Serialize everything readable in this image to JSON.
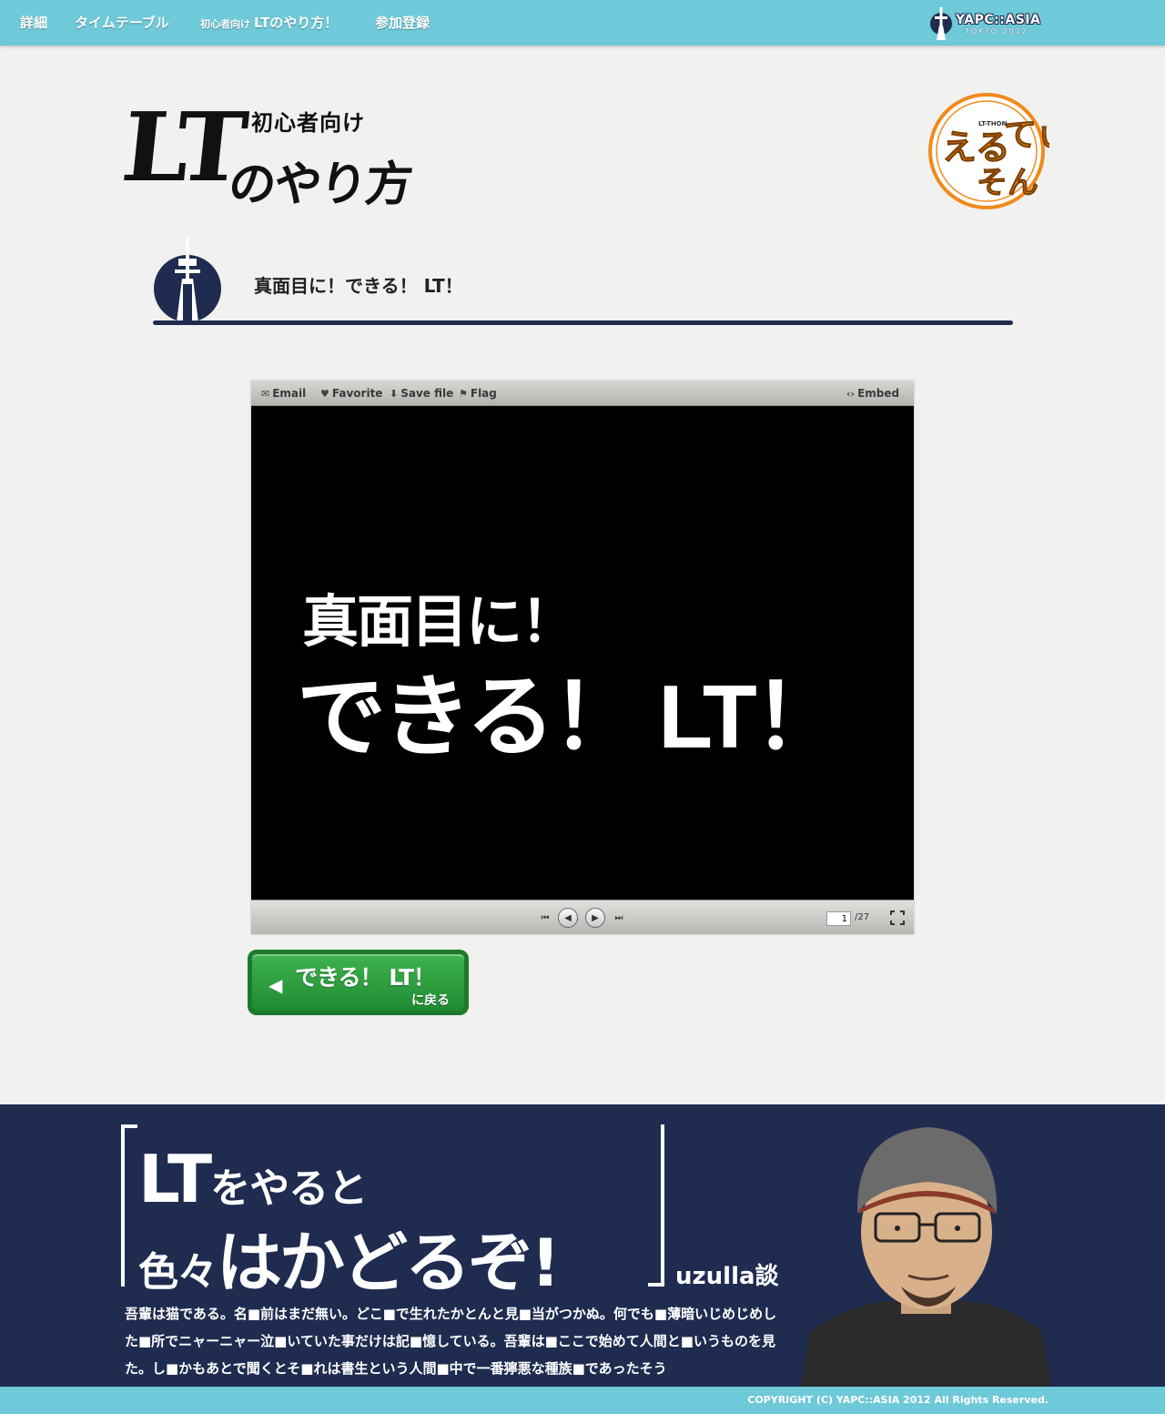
{
  "nav": {
    "items": [
      {
        "label": "詳細"
      },
      {
        "label": "タイムテーブル"
      },
      {
        "prefix": "初心者向け",
        "label": "LTのやり方！"
      },
      {
        "label": "参加登録"
      }
    ],
    "logo": {
      "title": "YAPC::ASIA",
      "subtitle": "TOKYO 2012"
    }
  },
  "header": {
    "title_prefix": "初心者向け",
    "title_lt": "LT",
    "title_rest": "のやり方",
    "badge": {
      "label": "えるてぃーそん",
      "small_text": "LT-THON",
      "icon": "lt-thon-badge-icon"
    }
  },
  "section": {
    "icon": "tower-icon",
    "title": "真面目に！できる！ LT！"
  },
  "viewer": {
    "toolbar": {
      "email": "Email",
      "favorite": "Favorite",
      "save_file": "Save file",
      "flag": "Flag",
      "embed": "Embed"
    },
    "slide": {
      "line1": "真面目に！",
      "line2": "できる！ LT！"
    },
    "controls": {
      "current_page": "1",
      "total_pages": "/27"
    }
  },
  "back_button": {
    "main": "できる！ LT！",
    "sub": "に戻る"
  },
  "promo": {
    "headline1_big": "LT",
    "headline1_rest": "をやると",
    "headline2_small": "色々",
    "headline2_big": "はかどるぞ!",
    "attribution": "uzulla談",
    "body": "吾輩は猫である。名■前はまだ無い。どこ■で生れたかとんと見■当がつかぬ。何でも■薄暗いじめじめした■所でニャーニャー泣■いていた事だけは記■憶している。吾輩は■ここで始めて人間と■いうものを見た。し■かもあとで聞くとそ■れは書生という人間■中で一番獰悪な種族■であったそう"
  },
  "footer": {
    "copyright": "COPYRIGHT (C) YAPC::ASIA 2012 All Rights Reserved."
  },
  "colors": {
    "nav_bg": "#6ec9d8",
    "navy": "#1f2c50",
    "button_green": "#2a9d3d",
    "badge_orange": "#f08a1c"
  }
}
